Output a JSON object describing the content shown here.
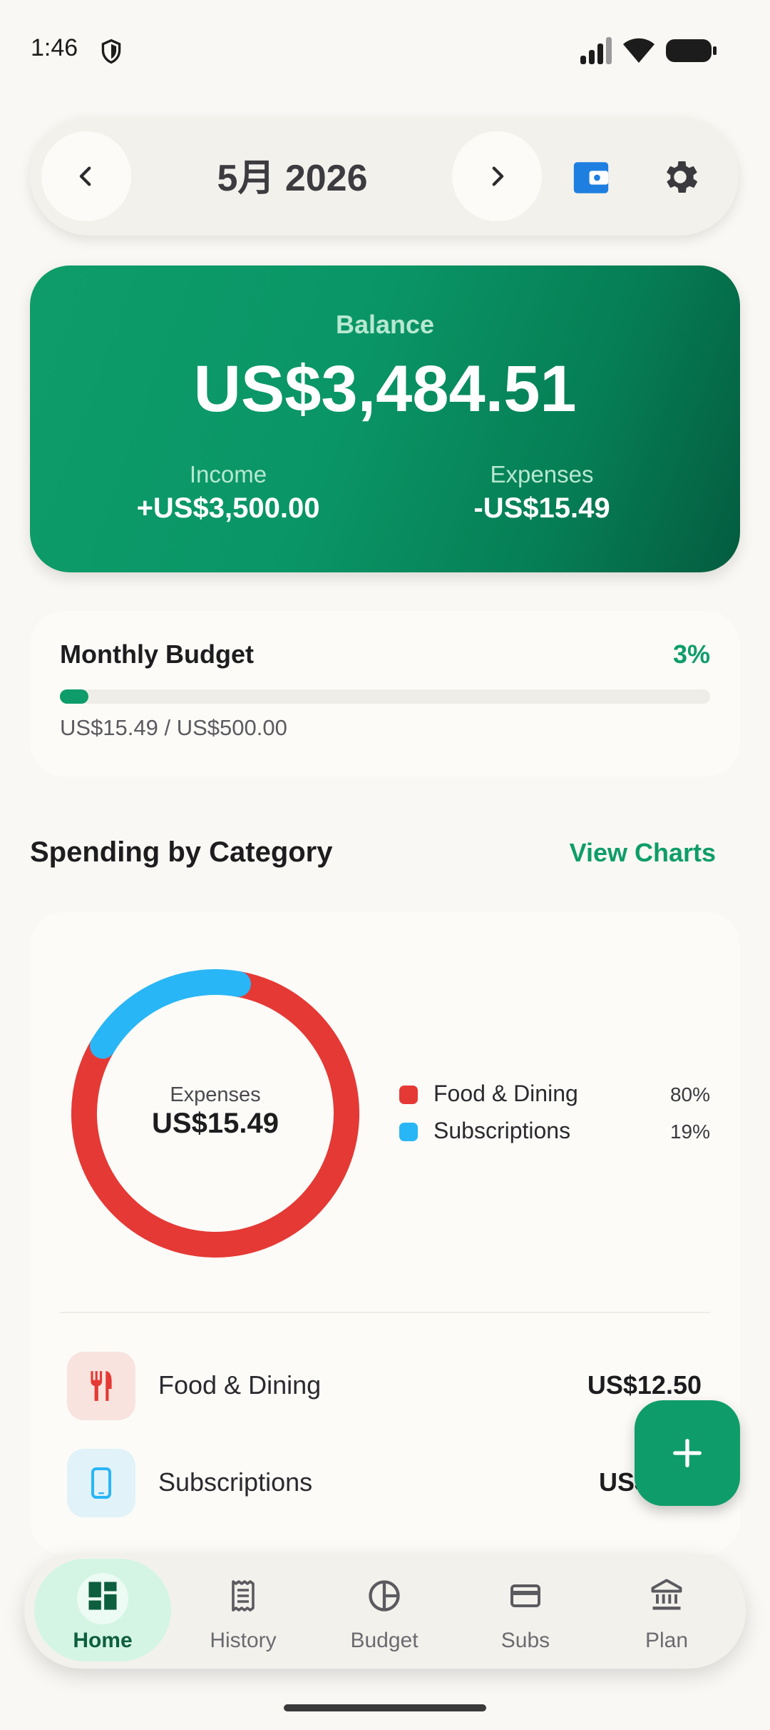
{
  "status_bar": {
    "time": "1:46",
    "icons": [
      "shield-icon",
      "signal-icon",
      "wifi-icon",
      "battery-icon"
    ]
  },
  "header": {
    "month_title": "5月 2026",
    "icons": [
      "chevron-left-icon",
      "chevron-right-icon",
      "wallet-icon",
      "gear-icon"
    ]
  },
  "balance": {
    "label": "Balance",
    "amount": "US$3,484.51",
    "income_label": "Income",
    "income_value": "+US$3,500.00",
    "expenses_label": "Expenses",
    "expenses_value": "-US$15.49"
  },
  "budget": {
    "title": "Monthly Budget",
    "percent_label": "3%",
    "progress_fraction": 0.03,
    "amounts": "US$15.49 / US$500.00"
  },
  "spending": {
    "title": "Spending by Category",
    "view_charts": "View Charts",
    "donut_label": "Expenses",
    "donut_value": "US$15.49",
    "legend": [
      {
        "name": "Food & Dining",
        "pct": "80%",
        "color": "#E53935"
      },
      {
        "name": "Subscriptions",
        "pct": "19%",
        "color": "#29B6F6"
      }
    ],
    "categories": [
      {
        "name": "Food & Dining",
        "amount": "US$12.50",
        "icon": "fork-knife-icon",
        "color": "#E53935",
        "bg": "#F8E3DE"
      },
      {
        "name": "Subscriptions",
        "amount": "US$",
        "icon": "phone-icon",
        "color": "#29B6F6",
        "bg": "#E1F2F9"
      }
    ]
  },
  "chart_data": {
    "type": "pie",
    "categories": [
      "Food & Dining",
      "Subscriptions"
    ],
    "values": [
      80,
      19
    ]
  },
  "fab": {
    "icon": "plus-icon"
  },
  "nav": {
    "items": [
      {
        "label": "Home",
        "icon": "dashboard-icon"
      },
      {
        "label": "History",
        "icon": "receipt-icon"
      },
      {
        "label": "Budget",
        "icon": "pie-chart-icon"
      },
      {
        "label": "Subs",
        "icon": "credit-card-icon"
      },
      {
        "label": "Plan",
        "icon": "bank-icon"
      }
    ]
  },
  "colors": {
    "accent": "#0E9D6A",
    "background": "#FAF8F4",
    "food": "#E53935",
    "subscriptions": "#29B6F6"
  }
}
